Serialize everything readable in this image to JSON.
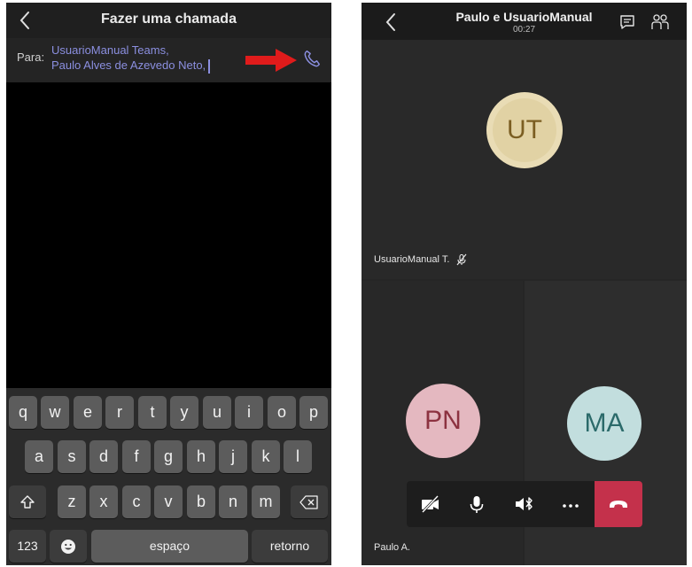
{
  "left_screen": {
    "title": "Fazer uma chamada",
    "to_label": "Para:",
    "recipients": [
      "UsuarioManual Teams,",
      "Paulo Alves de Azevedo Neto,"
    ],
    "keyboard": {
      "row1": [
        "q",
        "w",
        "e",
        "r",
        "t",
        "y",
        "u",
        "i",
        "o",
        "p"
      ],
      "row2": [
        "a",
        "s",
        "d",
        "f",
        "g",
        "h",
        "j",
        "k",
        "l"
      ],
      "row3": [
        "z",
        "x",
        "c",
        "v",
        "b",
        "n",
        "m"
      ],
      "numbers_key": "123",
      "space_key": "espaço",
      "return_key": "retorno"
    }
  },
  "right_screen": {
    "call_title": "Paulo e UsuarioManual",
    "timer": "00:27",
    "participants": [
      {
        "initials": "UT",
        "name": "UsuarioManual T.",
        "muted": true
      },
      {
        "initials": "PN",
        "name": "Paulo A."
      },
      {
        "initials": "MA"
      }
    ],
    "more_label": "•••"
  },
  "colors": {
    "accent": "#8b8fe0",
    "hangup": "#c4314b",
    "annotation_arrow": "#e01b1b"
  },
  "icons": [
    "back-icon",
    "phone-call-icon",
    "shift-icon",
    "backspace-icon",
    "emoji-icon",
    "chat-icon",
    "people-icon",
    "video-off-icon",
    "microphone-icon",
    "speaker-bluetooth-icon",
    "more-icon",
    "hang-up-icon",
    "mic-off-icon"
  ]
}
